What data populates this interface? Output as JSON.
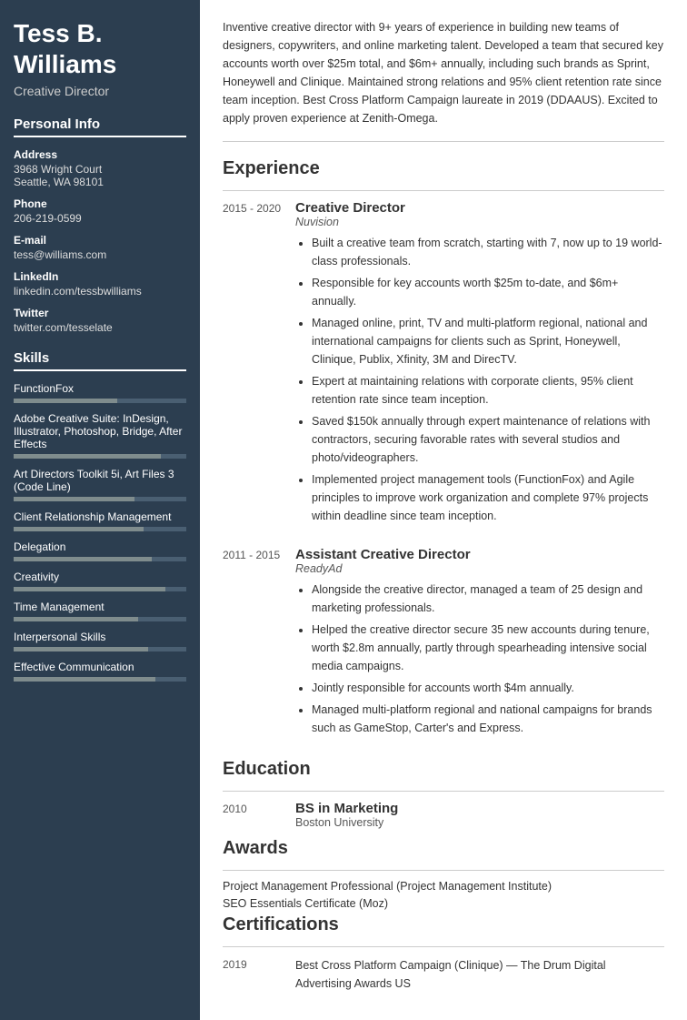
{
  "sidebar": {
    "name": "Tess B. Williams",
    "title": "Creative Director",
    "personal_info_label": "Personal Info",
    "address_label": "Address",
    "address_line1": "3968 Wright Court",
    "address_line2": "Seattle, WA 98101",
    "phone_label": "Phone",
    "phone": "206-219-0599",
    "email_label": "E-mail",
    "email": "tess@williams.com",
    "linkedin_label": "LinkedIn",
    "linkedin": "linkedin.com/tessbwilliams",
    "twitter_label": "Twitter",
    "twitter": "twitter.com/tesselate",
    "skills_label": "Skills",
    "skills": [
      {
        "name": "FunctionFox",
        "level": 60
      },
      {
        "name": "Adobe Creative Suite: InDesign, Illustrator, Photoshop, Bridge, After Effects",
        "level": 85
      },
      {
        "name": "Art Directors Toolkit 5i, Art Files 3 (Code Line)",
        "level": 70
      },
      {
        "name": "Client Relationship Management",
        "level": 75
      },
      {
        "name": "Delegation",
        "level": 80
      },
      {
        "name": "Creativity",
        "level": 88
      },
      {
        "name": "Time Management",
        "level": 72
      },
      {
        "name": "Interpersonal Skills",
        "level": 78
      },
      {
        "name": "Effective Communication",
        "level": 82
      }
    ]
  },
  "main": {
    "summary": "Inventive creative director with 9+ years of experience in building new teams of designers, copywriters, and online marketing talent. Developed a team that secured key accounts worth over $25m total, and $6m+ annually, including such brands as Sprint, Honeywell and Clinique. Maintained strong relations and 95% client retention rate since team inception. Best Cross Platform Campaign laureate in 2019 (DDAAUS). Excited to apply proven experience at Zenith-Omega.",
    "experience_label": "Experience",
    "experiences": [
      {
        "date": "2015 - 2020",
        "title": "Creative Director",
        "company": "Nuvision",
        "bullets": [
          "Built a creative team from scratch, starting with 7, now up to 19 world-class professionals.",
          "Responsible for key accounts worth $25m to-date, and $6m+ annually.",
          "Managed online, print, TV and multi-platform regional, national and international campaigns for clients such as Sprint, Honeywell, Clinique, Publix, Xfinity, 3M and DirecTV.",
          "Expert at maintaining relations with corporate clients, 95% client retention rate since team inception.",
          "Saved $150k annually through expert maintenance of relations with contractors, securing favorable rates with several studios and photo/videographers.",
          "Implemented project management tools (FunctionFox) and Agile principles to improve work organization and complete 97% projects within deadline since team inception."
        ]
      },
      {
        "date": "2011 - 2015",
        "title": "Assistant Creative Director",
        "company": "ReadyAd",
        "bullets": [
          "Alongside the creative director, managed a team of 25 design and marketing professionals.",
          "Helped the creative director secure 35 new accounts during tenure, worth $2.8m annually, partly through spearheading intensive social media campaigns.",
          "Jointly responsible for accounts worth $4m annually.",
          "Managed multi-platform regional and national campaigns for brands such as GameStop, Carter's and Express."
        ]
      }
    ],
    "education_label": "Education",
    "education": [
      {
        "date": "2010",
        "degree": "BS in Marketing",
        "school": "Boston University"
      }
    ],
    "awards_label": "Awards",
    "awards": [
      "Project Management Professional (Project Management Institute)",
      "SEO Essentials Certificate (Moz)"
    ],
    "certifications_label": "Certifications",
    "certifications": [
      {
        "date": "2019",
        "text": "Best Cross Platform Campaign (Clinique) — The Drum Digital Advertising Awards US"
      }
    ]
  }
}
